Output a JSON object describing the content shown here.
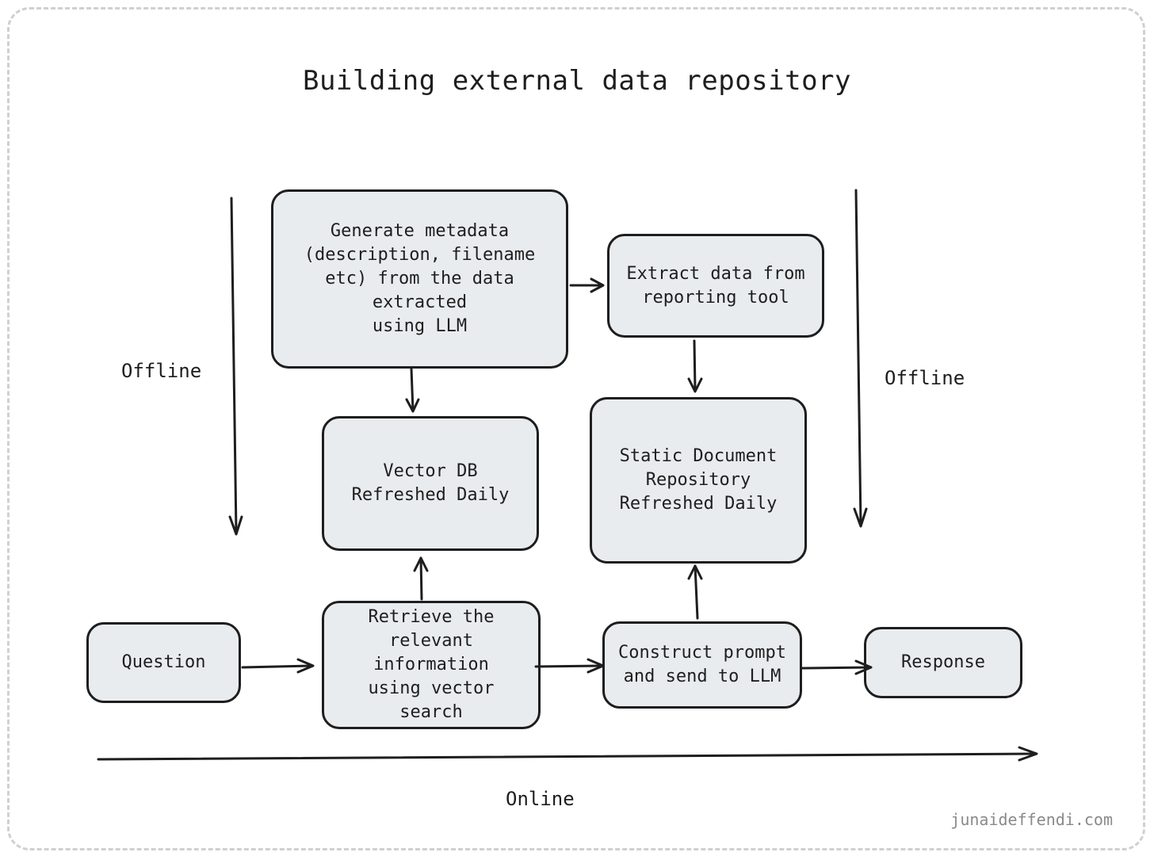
{
  "title": "Building external data repository",
  "nodes": {
    "generate_metadata": "Generate metadata\n(description, filename\netc) from the data\nextracted\nusing LLM",
    "extract_data": "Extract data from\nreporting tool",
    "vector_db": "Vector DB\nRefreshed Daily",
    "static_repo": "Static Document\nRepository\nRefreshed Daily",
    "question": "Question",
    "retrieve": "Retrieve the\nrelevant\ninformation\nusing vector\nsearch",
    "construct_prompt": "Construct prompt\nand send to LLM",
    "response": "Response"
  },
  "labels": {
    "offline_left": "Offline",
    "offline_right": "Offline",
    "online": "Online"
  },
  "watermark": "junaideffendi.com",
  "colors": {
    "node_fill": "#e9ecef",
    "stroke": "#1e1e1e",
    "frame": "#d0d0d0",
    "watermark": "#8a8a8a"
  }
}
